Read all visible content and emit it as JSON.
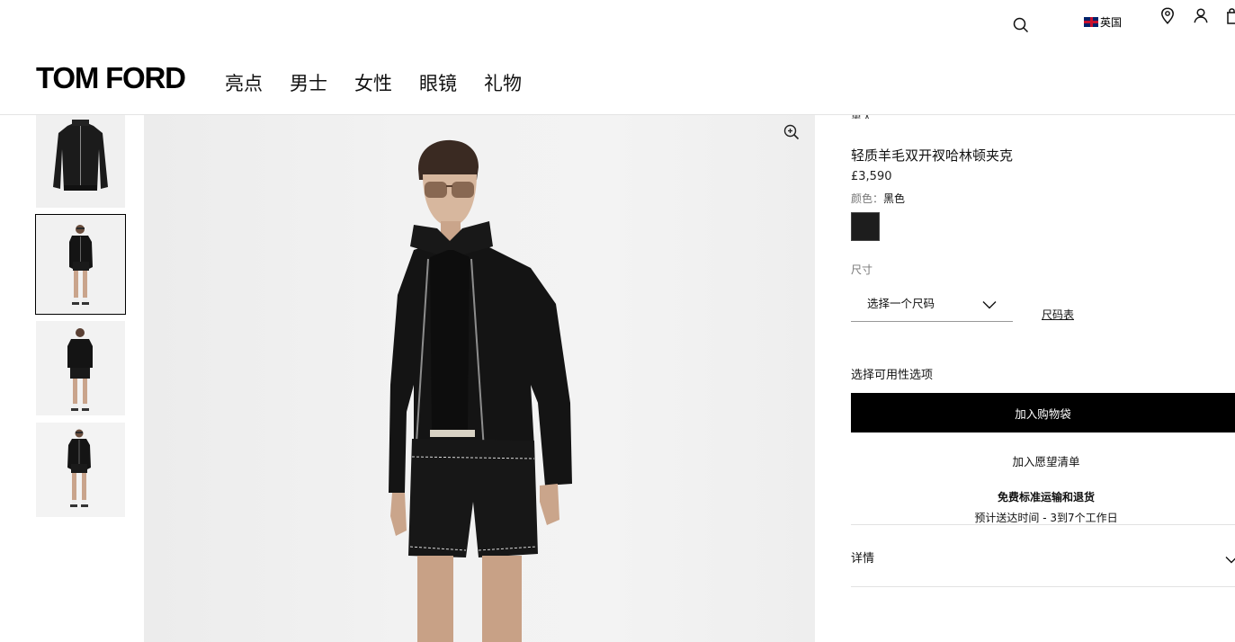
{
  "header": {
    "brand": "TOM FORD",
    "nav": [
      "亮点",
      "男士",
      "女性",
      "眼镜",
      "礼物"
    ],
    "locale": "英国",
    "icons": [
      "search-icon",
      "location-pin-icon",
      "account-icon",
      "shopping-bag-icon"
    ]
  },
  "gallery": {
    "thumbnails": [
      "jacket-flat-view",
      "model-front-view",
      "model-back-view",
      "model-full-length-view"
    ],
    "active_index": 1,
    "zoom_icon": "zoom-in-icon"
  },
  "product": {
    "category": "男人",
    "title": "轻质羊毛双开衩哈林顿夹克",
    "price": "£3,590",
    "color_label": "颜色：",
    "color_value": "黑色",
    "swatch_color": "#1d1d1d",
    "size_label": "尺寸",
    "size_placeholder": "选择一个尺码",
    "size_chart": "尺码表",
    "availability": "选择可用性选项",
    "add_to_bag": "加入购物袋",
    "wishlist": "加入愿望清单",
    "shipping_title": "免费标准运输和退货",
    "shipping_sub": "预计送达时间 - 3到7个工作日",
    "details": "详情"
  }
}
